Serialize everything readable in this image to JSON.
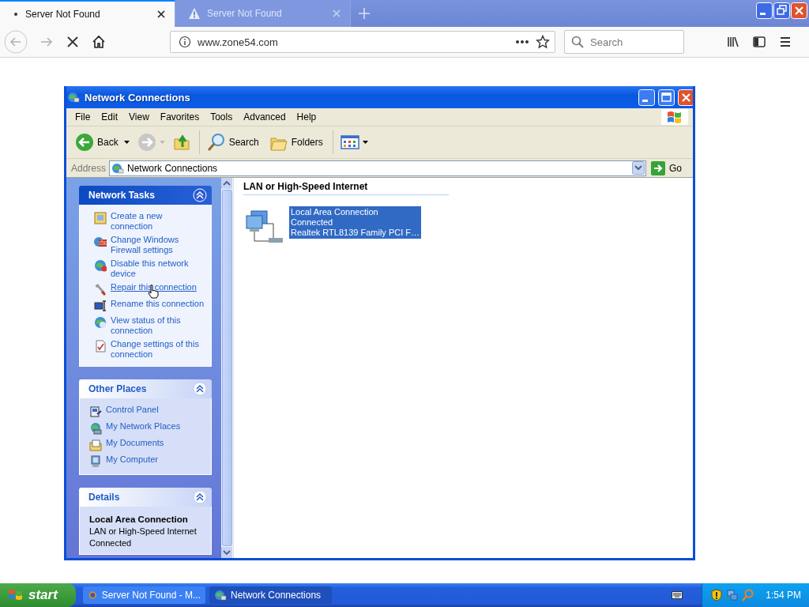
{
  "browser": {
    "tabs": [
      {
        "kind": "loading",
        "title": "Server Not Found",
        "selected": true
      },
      {
        "kind": "warning",
        "title": "Server Not Found",
        "selected": false
      }
    ],
    "url": "www.zone54.com",
    "search": {
      "placeholder": "Search"
    }
  },
  "window": {
    "title": "Network Connections",
    "menu": [
      "File",
      "Edit",
      "View",
      "Favorites",
      "Tools",
      "Advanced",
      "Help"
    ],
    "toolbar": [
      {
        "kind": "back",
        "label": "Back"
      },
      {
        "kind": "forward"
      },
      {
        "kind": "up"
      },
      {
        "kind": "search",
        "label": "Search"
      },
      {
        "kind": "folders",
        "label": "Folders"
      },
      {
        "kind": "views"
      }
    ],
    "address": {
      "label": "Address",
      "value": "Network Connections",
      "go": "Go"
    }
  },
  "task_panels": [
    {
      "title": "Network Tasks",
      "kind": "primary",
      "items": [
        {
          "kind": "new",
          "label": "Create a new connection",
          "hovered": false
        },
        {
          "kind": "firewall",
          "label": "Change Windows Firewall settings",
          "hovered": false
        },
        {
          "kind": "disable",
          "label": "Disable this network device",
          "hovered": false
        },
        {
          "kind": "repair",
          "label": "Repair this connection",
          "hovered": true
        },
        {
          "kind": "rename",
          "label": "Rename this connection",
          "hovered": false
        },
        {
          "kind": "status",
          "label": "View status of this connection",
          "hovered": false
        },
        {
          "kind": "settings",
          "label": "Change settings of this connection",
          "hovered": false
        }
      ]
    },
    {
      "title": "Other Places",
      "kind": "normal",
      "items": [
        {
          "kind": "control",
          "label": "Control Panel",
          "hovered": false
        },
        {
          "kind": "network",
          "label": "My Network Places",
          "hovered": false
        },
        {
          "kind": "documents",
          "label": "My Documents",
          "hovered": false
        },
        {
          "kind": "computer",
          "label": "My Computer",
          "hovered": false
        }
      ]
    },
    {
      "title": "Details",
      "kind": "details",
      "heading": "Local Area Connection",
      "lines": [
        "LAN or High-Speed Internet",
        "Connected"
      ]
    }
  ],
  "group": {
    "title": "LAN or High-Speed Internet",
    "items": [
      {
        "lines": [
          "Local Area Connection",
          "Connected",
          "Realtek RTL8139 Family PCI F…"
        ],
        "selected": true
      }
    ]
  },
  "taskbar": {
    "start": "start",
    "tasks": [
      {
        "kind": "browser",
        "label": "Server Not Found - M...",
        "selected": false
      },
      {
        "kind": "network",
        "label": "Network Connections",
        "selected": true
      }
    ],
    "clock": "1:54 PM"
  }
}
